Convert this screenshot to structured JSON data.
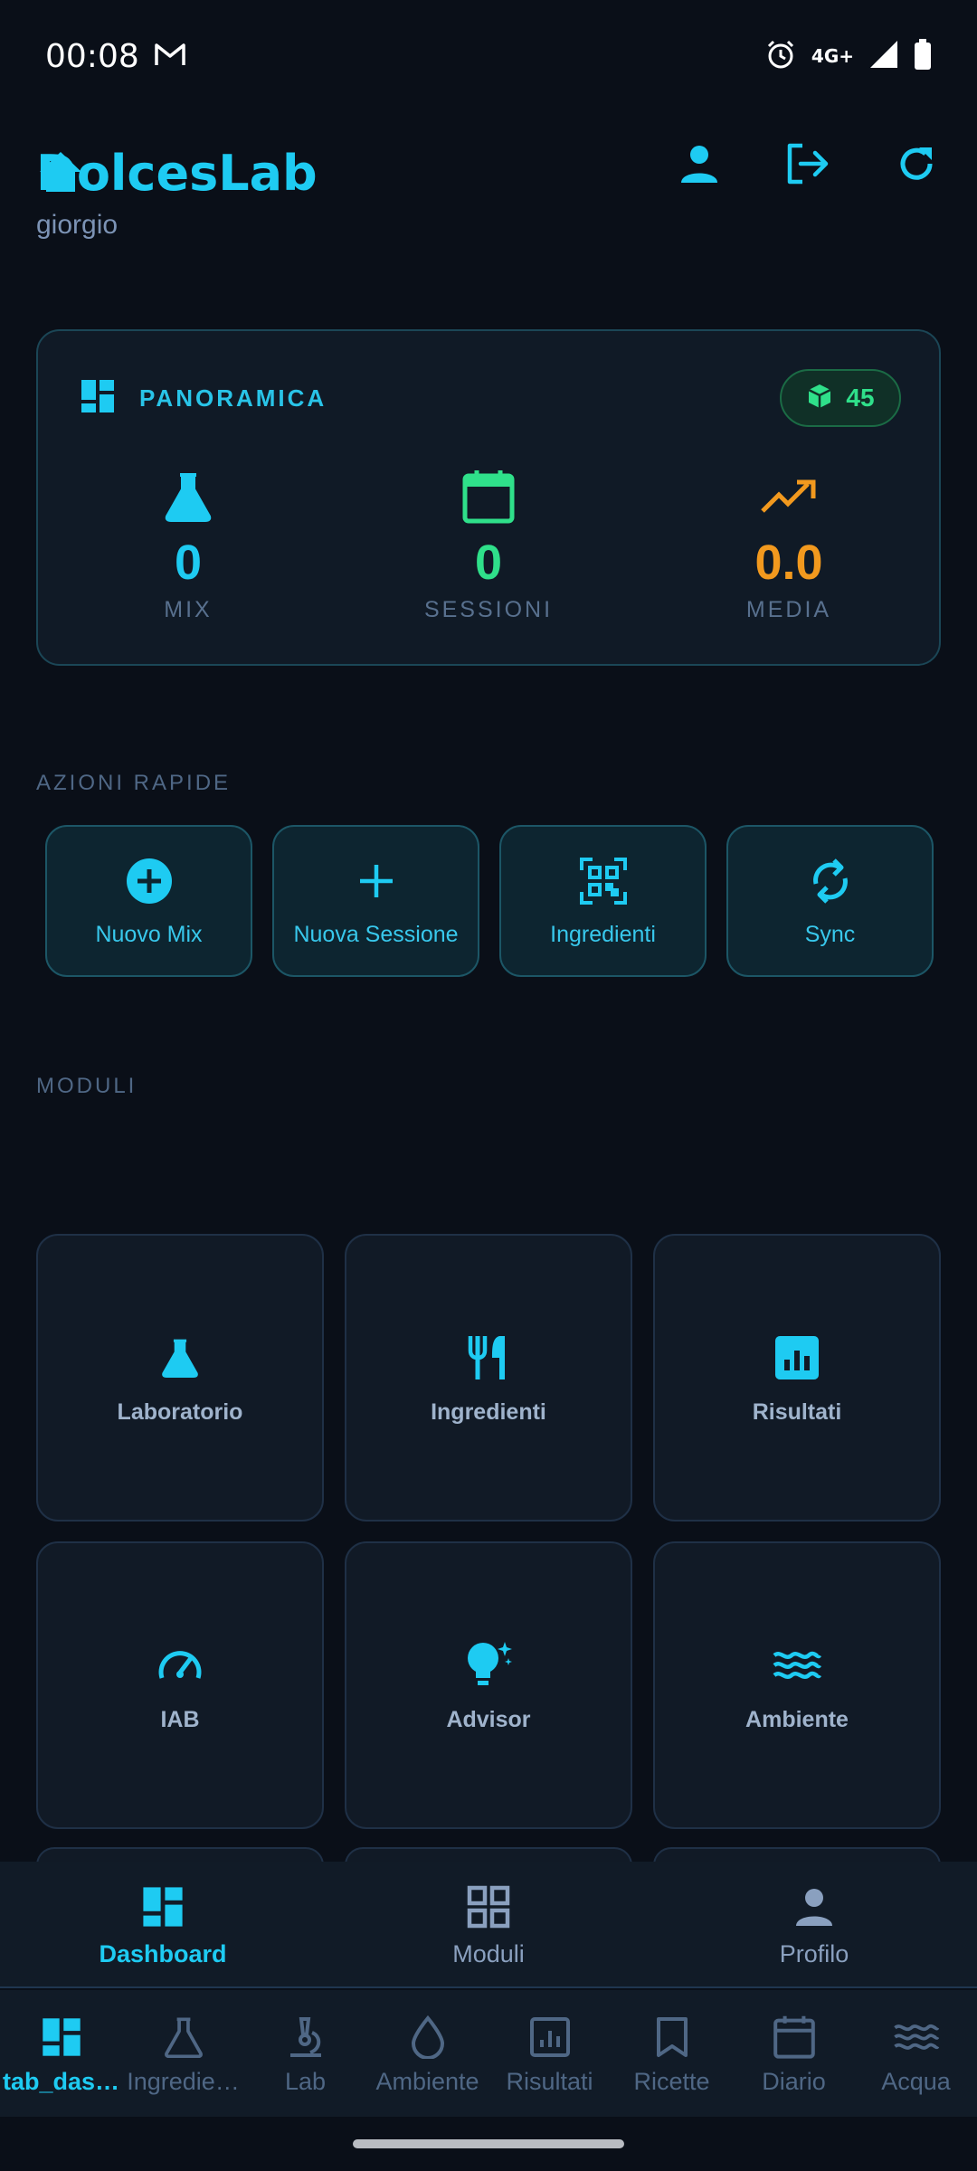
{
  "status_bar": {
    "time": "00:08",
    "network": "4G+"
  },
  "header": {
    "app_title": "DolcesLab",
    "user_name": "giorgio"
  },
  "colors": {
    "accent": "#1ecbf2",
    "green": "#2fe08a",
    "orange": "#f2991e",
    "bg": "#0a0f18"
  },
  "overview": {
    "title": "PANORAMICA",
    "badge_count": "45",
    "stats": [
      {
        "value": "0",
        "label": "MIX",
        "icon": "flask-icon",
        "color": "#1ecbf2"
      },
      {
        "value": "0",
        "label": "SESSIONI",
        "icon": "calendar-icon",
        "color": "#2fe08a"
      },
      {
        "value": "0.0",
        "label": "MEDIA",
        "icon": "trending-up-icon",
        "color": "#f2991e"
      }
    ]
  },
  "quick_actions": {
    "title": "AZIONI RAPIDE",
    "items": [
      {
        "label": "Nuovo Mix",
        "icon": "plus-circle-icon"
      },
      {
        "label": "Nuova Sessione",
        "icon": "plus-icon"
      },
      {
        "label": "Ingredienti",
        "icon": "qr-code-icon"
      },
      {
        "label": "Sync",
        "icon": "sync-icon"
      }
    ]
  },
  "modules": {
    "title": "MODULI",
    "items": [
      {
        "label": "Laboratorio",
        "icon": "flask-icon"
      },
      {
        "label": "Ingredienti",
        "icon": "utensils-icon"
      },
      {
        "label": "Risultati",
        "icon": "bar-chart-icon"
      },
      {
        "label": "IAB",
        "icon": "gauge-icon"
      },
      {
        "label": "Advisor",
        "icon": "lightbulb-icon"
      },
      {
        "label": "Ambiente",
        "icon": "waves-icon"
      }
    ]
  },
  "nav_top": {
    "items": [
      {
        "label": "Dashboard",
        "icon": "dashboard-icon",
        "active": true
      },
      {
        "label": "Moduli",
        "icon": "grid-icon",
        "active": false
      },
      {
        "label": "Profilo",
        "icon": "person-icon",
        "active": false
      }
    ]
  },
  "tabbar": {
    "items": [
      {
        "label": "tab_das…",
        "icon": "dashboard-icon",
        "active": true
      },
      {
        "label": "Ingredie…",
        "icon": "flask-outline-icon",
        "active": false
      },
      {
        "label": "Lab",
        "icon": "microscope-icon",
        "active": false
      },
      {
        "label": "Ambiente",
        "icon": "drop-icon",
        "active": false
      },
      {
        "label": "Risultati",
        "icon": "chart-outline-icon",
        "active": false
      },
      {
        "label": "Ricette",
        "icon": "bookmark-icon",
        "active": false
      },
      {
        "label": "Diario",
        "icon": "calendar-outline-icon",
        "active": false
      },
      {
        "label": "Acqua",
        "icon": "waves-outline-icon",
        "active": false
      }
    ]
  }
}
